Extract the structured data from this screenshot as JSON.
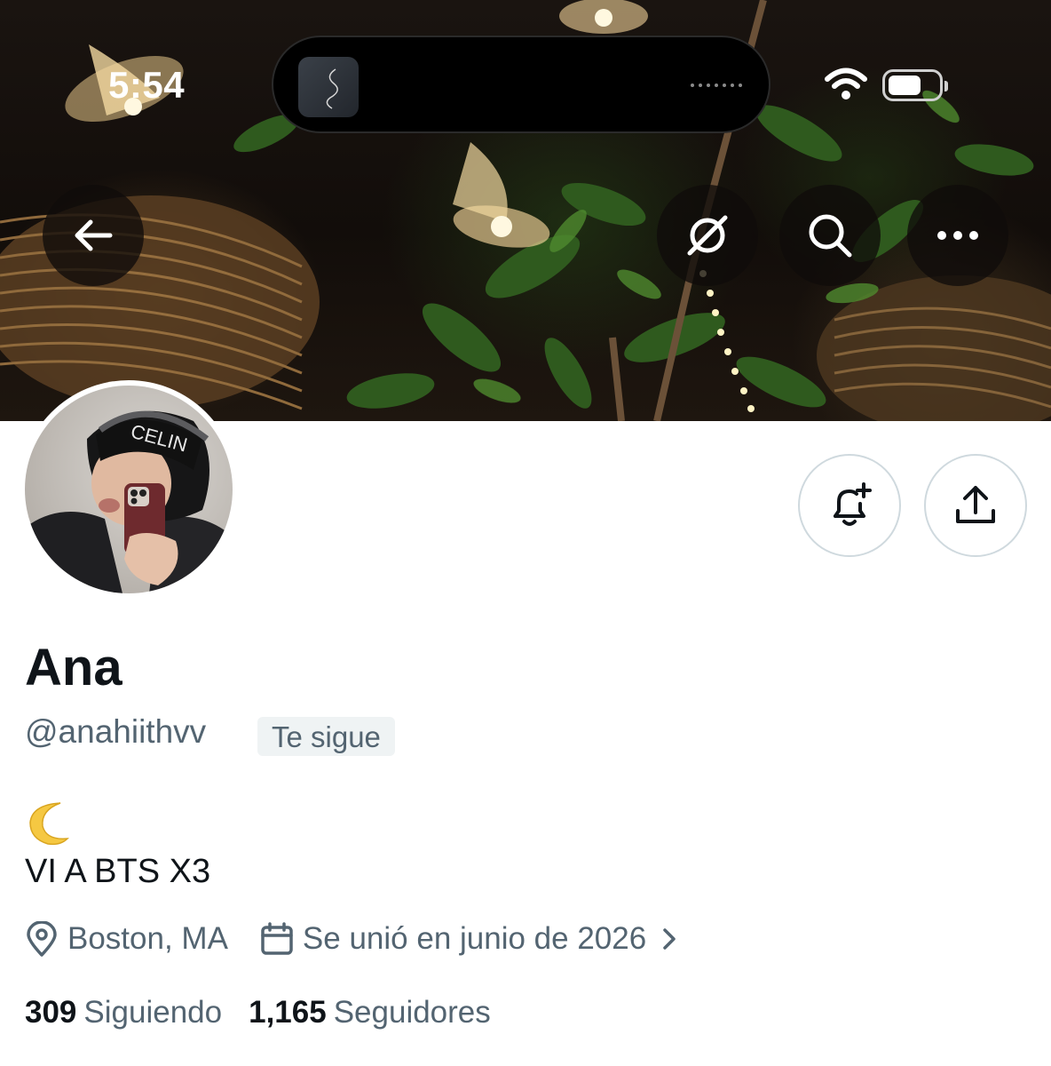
{
  "status_bar": {
    "time": "5:54",
    "wifi_icon": "wifi-icon",
    "battery_icon": "battery-icon"
  },
  "header": {
    "back_icon": "arrow-left-icon",
    "grok_icon": "grok-icon",
    "search_icon": "search-icon",
    "more_icon": "more-horizontal-icon"
  },
  "actions": {
    "notify_icon": "bell-plus-icon",
    "share_icon": "share-icon"
  },
  "profile": {
    "name": "Ana",
    "handle": "@anahiithvv",
    "follows_you_badge": "Te sigue",
    "bio_emoji": "🌙",
    "bio": "VI A BTS X3",
    "location": "Boston, MA",
    "joined": "Se unió en junio de 2026",
    "following_count": "309",
    "following_label": "Siguiendo",
    "followers_count": "1,165",
    "followers_label": "Seguidores"
  },
  "colors": {
    "text_primary": "#0f1419",
    "text_secondary": "#536471",
    "badge_bg": "#eff3f4",
    "border": "#cfd9de"
  }
}
